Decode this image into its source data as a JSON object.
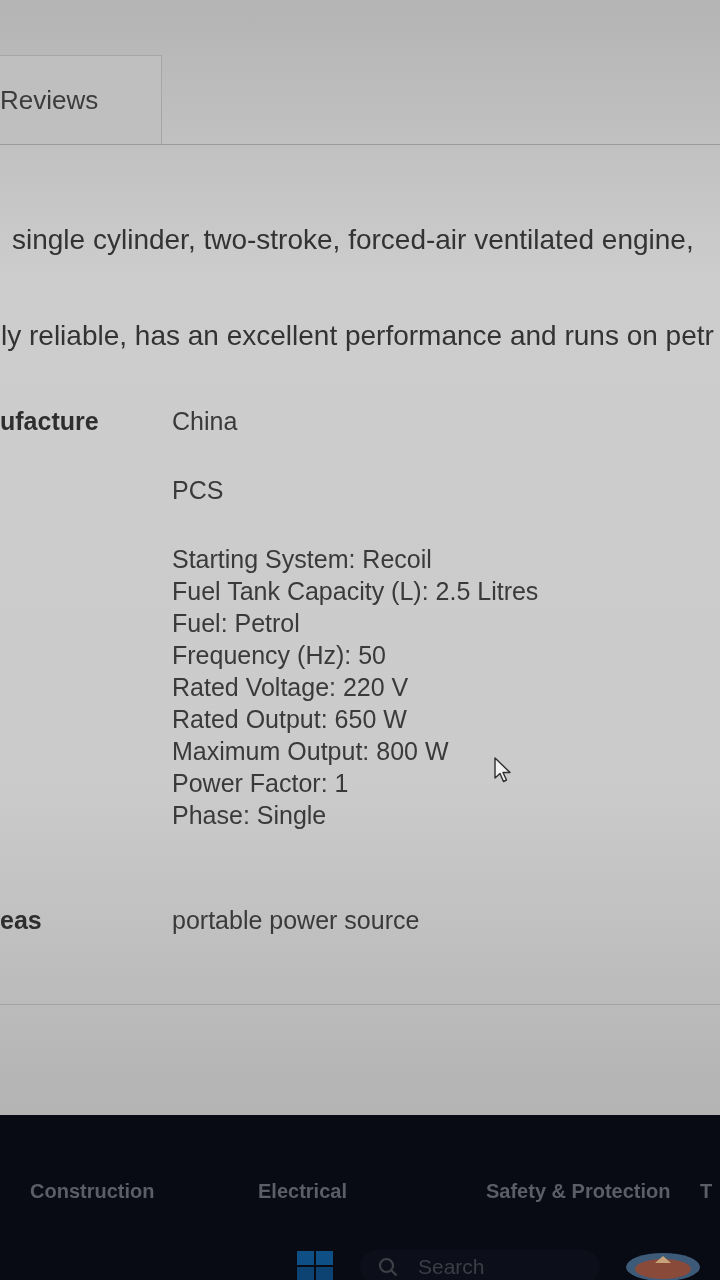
{
  "tabs": [
    {
      "label": "Reviews",
      "selected": false
    }
  ],
  "description": {
    "paragraphs": [
      "single cylinder, two-stroke, forced-air ventilated engine,",
      "ly reliable, has an excellent performance and runs on petr"
    ]
  },
  "specs": [
    {
      "label": "ufacture",
      "values": [
        "China"
      ]
    },
    {
      "values": [
        "PCS"
      ]
    },
    {
      "values": [
        "Starting System: Recoil",
        "Fuel Tank Capacity (L): 2.5 Litres",
        "Fuel: Petrol",
        "Frequency (Hz): 50",
        "Rated Voltage: 220 V",
        "Rated Output: 650 W",
        "Maximum Output: 800 W",
        "Power Factor: 1",
        "Phase: Single"
      ]
    },
    {
      "label": "eas",
      "values": [
        "portable power source"
      ]
    }
  ],
  "footer": {
    "links": [
      "Construction",
      "Electrical",
      "Safety & Protection",
      "T"
    ]
  },
  "taskbar": {
    "search": {
      "placeholder": "Search"
    }
  }
}
